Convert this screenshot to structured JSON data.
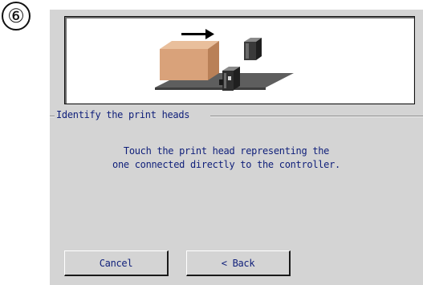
{
  "step": {
    "number": "6",
    "symbol": "⑥"
  },
  "illustration": {
    "icon": "packaging-line-illustration",
    "colors": {
      "box": "#d9a27a",
      "conveyor": "#5e5e5e",
      "print_head": "#2f2f2f",
      "arrow": "#000000"
    }
  },
  "group": {
    "title": "Identify the print heads"
  },
  "instruction": {
    "line1": "Touch the print head representing the",
    "line2": "one connected directly to the controller."
  },
  "buttons": {
    "cancel_label": "Cancel",
    "back_label": "< Back"
  },
  "colors": {
    "panel_bg": "#d4d4d4",
    "text": "#0f1f7a"
  }
}
